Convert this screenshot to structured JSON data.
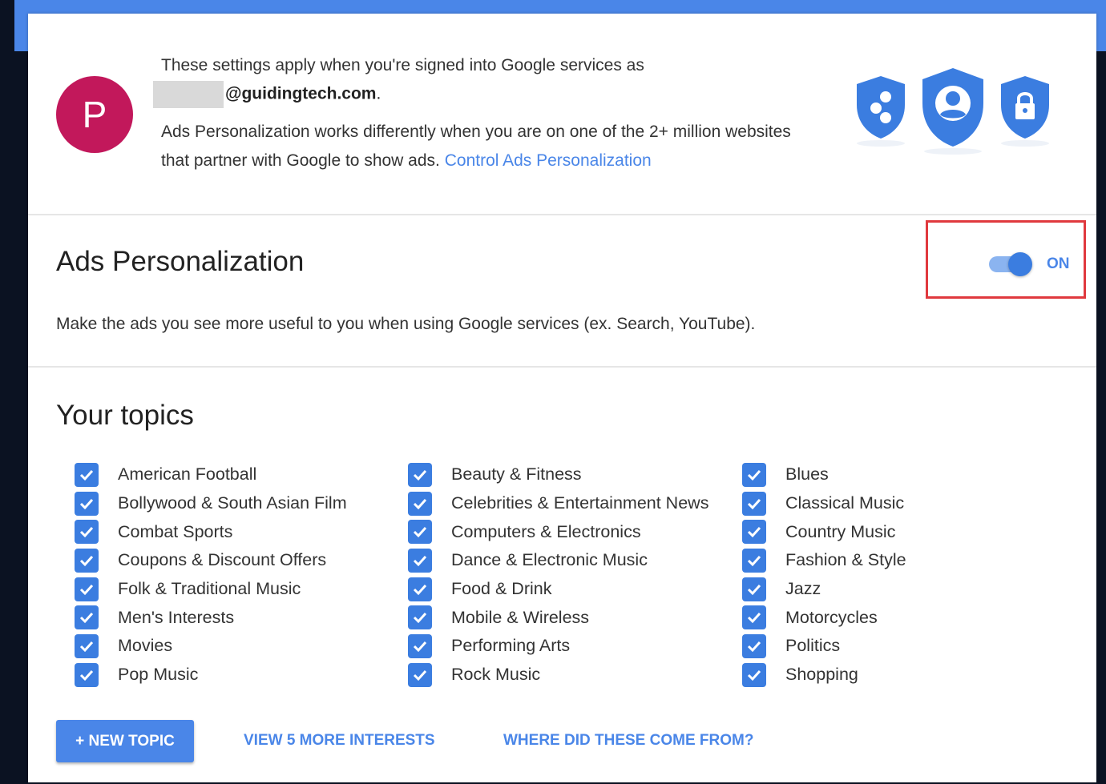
{
  "account": {
    "avatar_letter": "P",
    "signed_in_text": "These settings apply when you're signed into Google services as",
    "email_domain": "@guidingtech.com",
    "email_suffix": ".",
    "partner_text": "Ads Personalization works differently when you are on one of the 2+ million websites that partner with Google to show ads.",
    "control_link": "Control Ads Personalization"
  },
  "ads_personalization": {
    "title": "Ads Personalization",
    "description": "Make the ads you see more useful to you when using Google services (ex. Search, YouTube).",
    "toggle_state": "ON"
  },
  "topics": {
    "title": "Your topics",
    "columns": [
      [
        "American Football",
        "Bollywood & South Asian Film",
        "Combat Sports",
        "Coupons & Discount Offers",
        "Folk & Traditional Music",
        "Men's Interests",
        "Movies",
        "Pop Music"
      ],
      [
        "Beauty & Fitness",
        "Celebrities & Entertainment News",
        "Computers & Electronics",
        "Dance & Electronic Music",
        "Food & Drink",
        "Mobile & Wireless",
        "Performing Arts",
        "Rock Music"
      ],
      [
        "Blues",
        "Classical Music",
        "Country Music",
        "Fashion & Style",
        "Jazz",
        "Motorcycles",
        "Politics",
        "Shopping"
      ]
    ]
  },
  "actions": {
    "new_topic": "+ NEW TOPIC",
    "view_more": "VIEW 5 MORE INTERESTS",
    "where_from": "WHERE DID THESE COME FROM?"
  },
  "colors": {
    "accent": "#4a86e8",
    "avatar": "#c2185b",
    "highlight_box": "#e0393e"
  }
}
